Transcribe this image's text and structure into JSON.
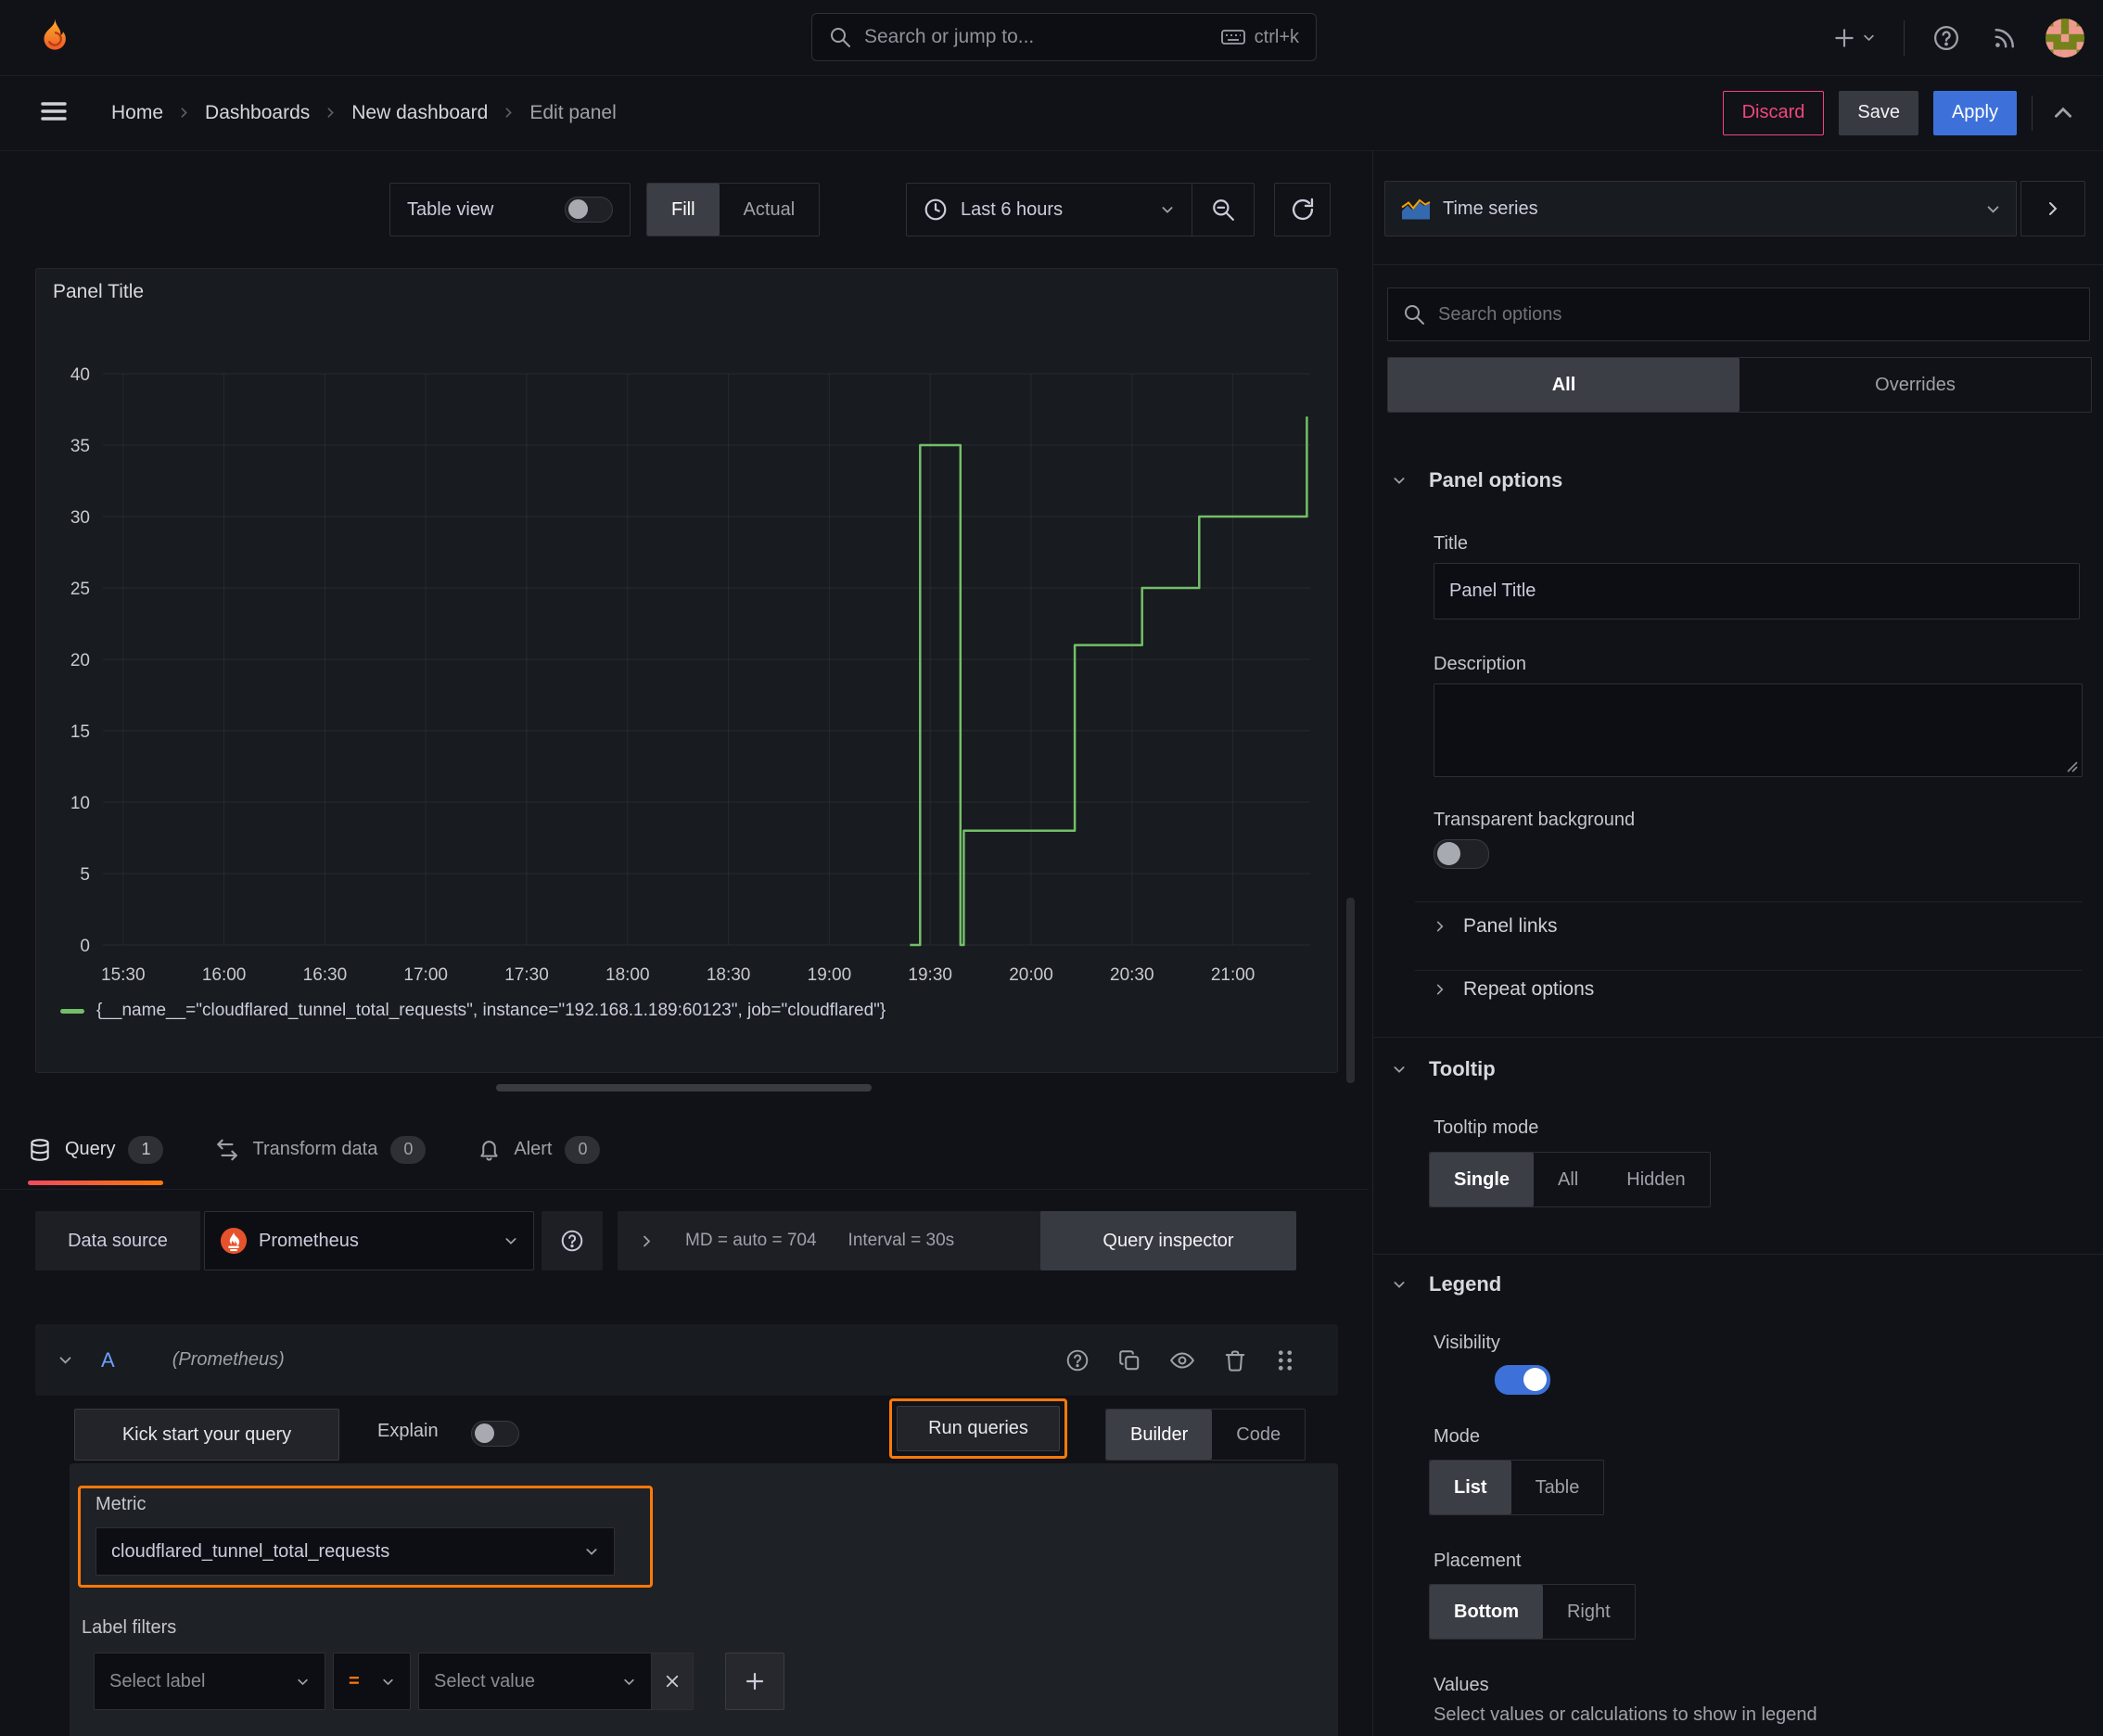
{
  "topnav": {
    "search_placeholder": "Search or jump to...",
    "search_shortcut": "ctrl+k"
  },
  "breadcrumb": {
    "items": [
      "Home",
      "Dashboards",
      "New dashboard",
      "Edit panel"
    ]
  },
  "actions": {
    "discard": "Discard",
    "save": "Save",
    "apply": "Apply"
  },
  "toolbar": {
    "table_view": "Table view",
    "fill": "Fill",
    "actual": "Actual",
    "time_range": "Last 6 hours"
  },
  "panel": {
    "title": "Panel Title",
    "legend": "{__name__=\"cloudflared_tunnel_total_requests\", instance=\"192.168.1.189:60123\", job=\"cloudflared\"}"
  },
  "chart_data": {
    "type": "line",
    "title": "Panel Title",
    "x_unit": "minutes_since_midnight",
    "x_domain": [
      924,
      1283
    ],
    "ylim": [
      0,
      40
    ],
    "y_ticks": [
      0,
      5,
      10,
      15,
      20,
      25,
      30,
      35,
      40
    ],
    "x_ticks": [
      {
        "t": 930,
        "label": "15:30"
      },
      {
        "t": 960,
        "label": "16:00"
      },
      {
        "t": 990,
        "label": "16:30"
      },
      {
        "t": 1020,
        "label": "17:00"
      },
      {
        "t": 1050,
        "label": "17:30"
      },
      {
        "t": 1080,
        "label": "18:00"
      },
      {
        "t": 1110,
        "label": "18:30"
      },
      {
        "t": 1140,
        "label": "19:00"
      },
      {
        "t": 1170,
        "label": "19:30"
      },
      {
        "t": 1200,
        "label": "20:00"
      },
      {
        "t": 1230,
        "label": "20:30"
      },
      {
        "t": 1260,
        "label": "21:00"
      }
    ],
    "grid": true,
    "legend_position": "bottom",
    "series": [
      {
        "name": "{__name__=\"cloudflared_tunnel_total_requests\", instance=\"192.168.1.189:60123\", job=\"cloudflared\"}",
        "color": "#73bf69",
        "points": [
          [
            1164,
            0
          ],
          [
            1167,
            0
          ],
          [
            1167,
            35
          ],
          [
            1179,
            35
          ],
          [
            1179,
            0
          ],
          [
            1180,
            0
          ],
          [
            1180,
            8
          ],
          [
            1213,
            8
          ],
          [
            1213,
            21
          ],
          [
            1233,
            21
          ],
          [
            1233,
            25
          ],
          [
            1250,
            25
          ],
          [
            1250,
            30
          ],
          [
            1282,
            30
          ],
          [
            1282,
            37
          ]
        ]
      }
    ]
  },
  "tabs": {
    "query": {
      "label": "Query",
      "count": "1"
    },
    "transform": {
      "label": "Transform data",
      "count": "0"
    },
    "alert": {
      "label": "Alert",
      "count": "0"
    }
  },
  "datasource": {
    "label": "Data source",
    "name": "Prometheus",
    "max_data_points": "MD = auto = 704",
    "interval": "Interval = 30s",
    "inspector": "Query inspector"
  },
  "query_row": {
    "refid": "A",
    "datasource": "(Prometheus)"
  },
  "query_actions": {
    "kickstart": "Kick start your query",
    "explain": "Explain",
    "run": "Run queries",
    "builder": "Builder",
    "code": "Code"
  },
  "metric": {
    "label": "Metric",
    "value": "cloudflared_tunnel_total_requests"
  },
  "label_filters": {
    "label": "Label filters",
    "select_label": "Select label",
    "operator": "=",
    "select_value": "Select value"
  },
  "sidebar": {
    "visualization": "Time series",
    "search_placeholder": "Search options",
    "tabs": {
      "all": "All",
      "overrides": "Overrides"
    },
    "panel_options": {
      "header": "Panel options",
      "title_label": "Title",
      "title_value": "Panel Title",
      "description_label": "Description",
      "transparent_label": "Transparent background",
      "panel_links": "Panel links",
      "repeat_options": "Repeat options"
    },
    "tooltip": {
      "header": "Tooltip",
      "mode_label": "Tooltip mode",
      "options": [
        "Single",
        "All",
        "Hidden"
      ],
      "selected": "Single"
    },
    "legend": {
      "header": "Legend",
      "visibility_label": "Visibility",
      "mode_label": "Mode",
      "mode_options": [
        "List",
        "Table"
      ],
      "mode_selected": "List",
      "placement_label": "Placement",
      "placement_options": [
        "Bottom",
        "Right"
      ],
      "placement_selected": "Bottom",
      "values_label": "Values",
      "values_description": "Select values or calculations to show in legend"
    }
  },
  "colors": {
    "accent_orange": "#ff780a",
    "series_green": "#73bf69",
    "primary_blue": "#3d71d9",
    "danger_pink": "#f1457e"
  }
}
